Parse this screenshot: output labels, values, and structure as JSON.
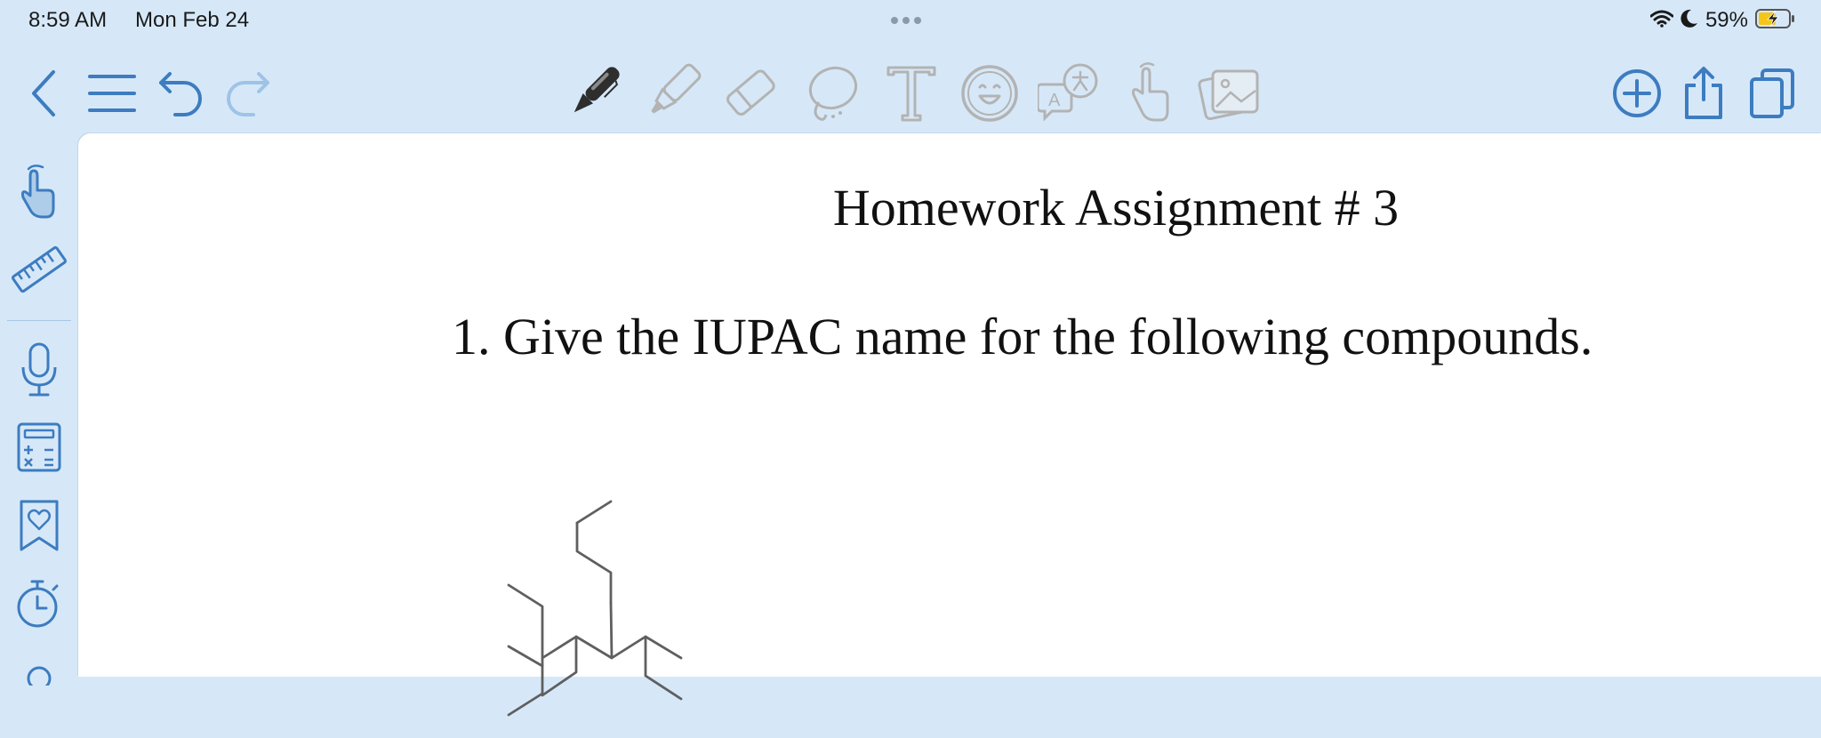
{
  "status_bar": {
    "time": "8:59 AM",
    "date": "Mon Feb 24",
    "battery_percent": "59%",
    "battery_level": 0.59
  },
  "toolbar": {
    "left": [
      {
        "name": "back",
        "icon": "chevron-left-icon"
      },
      {
        "name": "menu",
        "icon": "list-icon"
      },
      {
        "name": "undo",
        "icon": "undo-icon"
      },
      {
        "name": "redo",
        "icon": "redo-icon"
      }
    ],
    "tools": [
      {
        "name": "pen",
        "icon": "pen-icon",
        "selected": true
      },
      {
        "name": "highlighter",
        "icon": "highlighter-icon"
      },
      {
        "name": "eraser",
        "icon": "eraser-icon"
      },
      {
        "name": "lasso",
        "icon": "lasso-icon"
      },
      {
        "name": "text",
        "icon": "text-tool-icon"
      },
      {
        "name": "sticker",
        "icon": "sticker-icon"
      },
      {
        "name": "translate",
        "icon": "translate-icon"
      },
      {
        "name": "laser-pointer",
        "icon": "pointer-hand-icon"
      },
      {
        "name": "image",
        "icon": "image-icon"
      }
    ],
    "right": [
      {
        "name": "add",
        "icon": "plus-circle-icon"
      },
      {
        "name": "share",
        "icon": "share-icon"
      },
      {
        "name": "pages",
        "icon": "copy-pages-icon"
      }
    ]
  },
  "sidebar": {
    "items": [
      {
        "name": "hand",
        "icon": "hand-gesture-icon"
      },
      {
        "name": "ruler",
        "icon": "ruler-icon"
      },
      {
        "name": "microphone",
        "icon": "microphone-icon"
      },
      {
        "name": "calculator",
        "icon": "calculator-icon"
      },
      {
        "name": "bookmark",
        "icon": "bookmark-heart-icon"
      },
      {
        "name": "timer",
        "icon": "stopwatch-icon"
      }
    ]
  },
  "document": {
    "title": "Homework Assignment # 3",
    "question": "1. Give the IUPAC name for the following compounds."
  },
  "colors": {
    "chrome_background": "#d6e8f8",
    "icon_blue": "#3d7cc0",
    "icon_inactive": "#b3b3b3",
    "page": "#ffffff",
    "battery_fill": "#f5c518"
  }
}
